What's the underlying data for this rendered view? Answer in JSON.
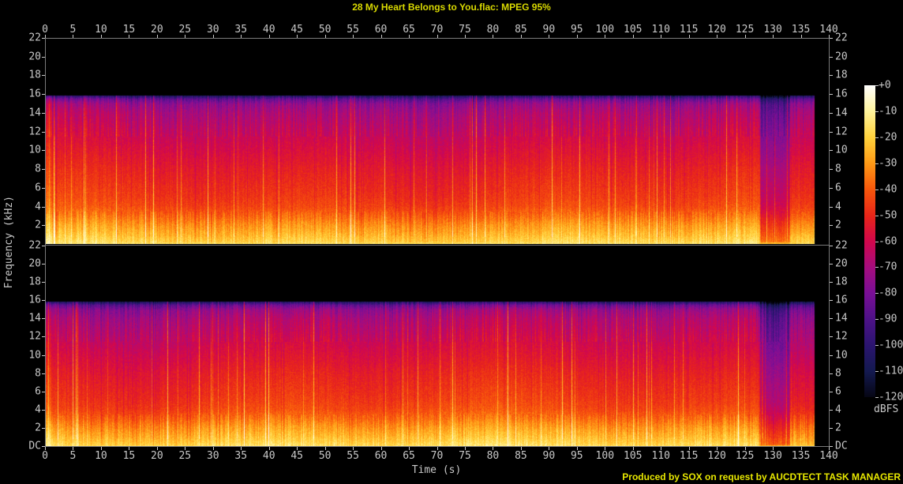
{
  "window": {
    "title": "28 My Heart Belongs to You.flac: MPEG 95%",
    "credit": "Produced by SOX on request by AUCDTECT TASK MANAGER"
  },
  "colors": {
    "background": "#000000",
    "title_text": "#d9d900",
    "credit_text": "#e8e800",
    "axis_text": "#c8c8c8",
    "axis_line": "#7a7a7a"
  },
  "chart_data": {
    "type": "heatmap",
    "subtype": "audio-spectrogram",
    "title": "28 My Heart Belongs to You.flac: MPEG 95%",
    "xlabel": "Time (s)",
    "ylabel": "Frequency (kHz)",
    "colorbar_label": "dBFS",
    "channels": 2,
    "x_range_s": [
      0,
      140
    ],
    "x_tick_step_s": 5,
    "x_tick_labels": [
      "0",
      "5",
      "10",
      "15",
      "20",
      "25",
      "30",
      "35",
      "40",
      "45",
      "50",
      "55",
      "60",
      "65",
      "70",
      "75",
      "80",
      "85",
      "90",
      "95",
      "100",
      "105",
      "110",
      "115",
      "120",
      "125",
      "130",
      "135",
      "140"
    ],
    "y_range_khz": [
      0,
      22
    ],
    "y_tick_labels_channel1": [
      "22",
      "20",
      "18",
      "16",
      "14",
      "12",
      "10",
      "8",
      "6",
      "4",
      "2"
    ],
    "y_tick_labels_channel2": [
      "22",
      "20",
      "18",
      "16",
      "14",
      "12",
      "10",
      "8",
      "6",
      "4",
      "2",
      "DC"
    ],
    "colorbar_tick_labels": [
      "+0",
      "-10",
      "-20",
      "-30",
      "-40",
      "-50",
      "-60",
      "-70",
      "-80",
      "-90",
      "-100",
      "-110",
      "-120"
    ],
    "colorbar_gradient": [
      {
        "db": 0,
        "color": "#ffffff"
      },
      {
        "db": -10,
        "color": "#fff49c"
      },
      {
        "db": -20,
        "color": "#ffd23c"
      },
      {
        "db": -30,
        "color": "#ff9a16"
      },
      {
        "db": -40,
        "color": "#f8570c"
      },
      {
        "db": -50,
        "color": "#e92619"
      },
      {
        "db": -60,
        "color": "#d2074d"
      },
      {
        "db": -70,
        "color": "#a60d7f"
      },
      {
        "db": -80,
        "color": "#7a0f97"
      },
      {
        "db": -90,
        "color": "#4e1288"
      },
      {
        "db": -100,
        "color": "#2b1570"
      },
      {
        "db": -110,
        "color": "#141a50"
      },
      {
        "db": -120,
        "color": "#060614"
      },
      {
        "db": -130,
        "color": "#000000"
      }
    ],
    "content": {
      "duration_s": 137.3,
      "bandwidth_cutoff_khz": 15.9,
      "quiet_section_s": [
        127.3,
        133.2
      ],
      "avg_level_dbfs_by_khz": [
        [
          0,
          -16
        ],
        [
          0.3,
          -19
        ],
        [
          1,
          -24
        ],
        [
          2,
          -30
        ],
        [
          3,
          -37
        ],
        [
          4,
          -43
        ],
        [
          5,
          -46
        ],
        [
          6,
          -48
        ],
        [
          8,
          -52
        ],
        [
          10,
          -57
        ],
        [
          12,
          -62
        ],
        [
          14,
          -68
        ],
        [
          15,
          -74
        ],
        [
          15.5,
          -84
        ],
        [
          15.9,
          -104
        ],
        [
          16,
          -130
        ]
      ]
    }
  }
}
